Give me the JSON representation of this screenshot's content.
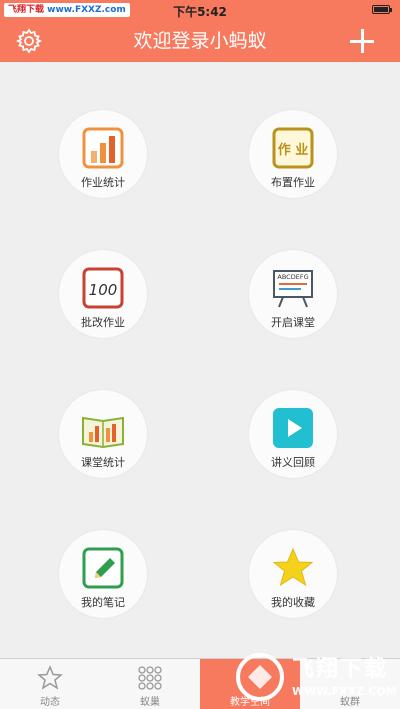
{
  "status_bar": {
    "watermark_part1": "飞翔下载",
    "watermark_part2": "www.FXXZ.com",
    "time": "下午5:42"
  },
  "nav": {
    "title": "欢迎登录小蚂蚁"
  },
  "grid": [
    {
      "label": "作业统计",
      "icon": "bar-chart-icon"
    },
    {
      "label": "布置作业",
      "icon": "homework-icon",
      "icon_text": "作 业"
    },
    {
      "label": "批改作业",
      "icon": "grade-100-icon",
      "icon_text": "100"
    },
    {
      "label": "开启课堂",
      "icon": "blackboard-icon",
      "icon_text": "ABCDEFG"
    },
    {
      "label": "课堂统计",
      "icon": "book-chart-icon"
    },
    {
      "label": "讲义回顾",
      "icon": "play-icon"
    },
    {
      "label": "我的笔记",
      "icon": "note-icon"
    },
    {
      "label": "我的收藏",
      "icon": "star-icon"
    }
  ],
  "tabbar": [
    {
      "label": "动态",
      "icon": "star-outline-icon"
    },
    {
      "label": "蚁巢",
      "icon": "dots-grid-icon"
    },
    {
      "label": "教学空间",
      "icon": "space-icon",
      "active": true
    },
    {
      "label": "蚁群",
      "icon": "group-icon"
    }
  ],
  "watermark": {
    "text": "飞翔下载",
    "url": "WWW.FXXZ.COM"
  },
  "colors": {
    "accent": "#f77a5f",
    "background": "#efefef"
  }
}
